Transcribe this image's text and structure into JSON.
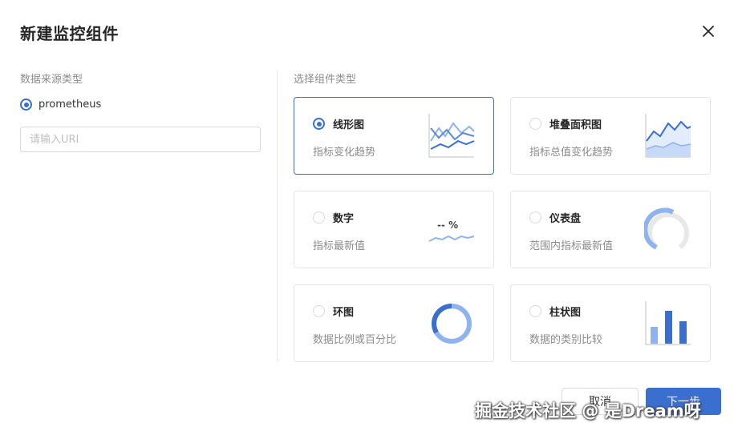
{
  "dialog": {
    "title": "新建监控组件",
    "close_icon": "close-icon"
  },
  "source": {
    "label": "数据来源类型",
    "options": [
      {
        "label": "prometheus",
        "checked": true
      }
    ],
    "uri_input": {
      "placeholder": "请输入URI",
      "value": ""
    }
  },
  "widget": {
    "label": "选择组件类型",
    "types": [
      {
        "name": "线形图",
        "desc": "指标变化趋势",
        "checked": true,
        "icon": "line-chart-icon"
      },
      {
        "name": "堆叠面积图",
        "desc": "指标总值变化趋势",
        "checked": false,
        "icon": "stacked-area-chart-icon"
      },
      {
        "name": "数字",
        "desc": "指标最新值",
        "checked": false,
        "icon": "number-stat-icon",
        "icon_text": "-- %"
      },
      {
        "name": "仪表盘",
        "desc": "范围内指标最新值",
        "checked": false,
        "icon": "gauge-icon"
      },
      {
        "name": "环图",
        "desc": "数据比例或百分比",
        "checked": false,
        "icon": "donut-chart-icon"
      },
      {
        "name": "柱状图",
        "desc": "数据的类别比较",
        "checked": false,
        "icon": "bar-chart-icon"
      }
    ]
  },
  "footer": {
    "cancel_label": "取消",
    "next_label": "下一步"
  },
  "watermark": "掘金技术社区 @ 是Dream呀",
  "colors": {
    "accent": "#3a6fd0",
    "accent_light": "#8fb3ee",
    "border": "#e5e5e5",
    "muted_text": "#8c8c8c"
  }
}
